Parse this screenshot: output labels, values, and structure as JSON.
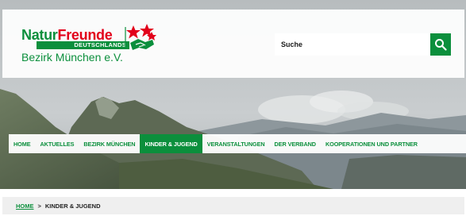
{
  "brand": {
    "name_part1": "Natur",
    "name_part2": "Freunde",
    "country": "DEUTSCHLANDS",
    "district": "Bezirk München e.V.",
    "mark_icon": "naturfreunde-handshake-roses-icon",
    "colors": {
      "green": "#0b8f3c",
      "red": "#e2001a"
    }
  },
  "search": {
    "placeholder": "Suche",
    "button_icon": "search-icon"
  },
  "nav": {
    "items": [
      {
        "label": "HOME"
      },
      {
        "label": "AKTUELLES"
      },
      {
        "label": "BEZIRK MÜNCHEN"
      },
      {
        "label": "KINDER & JUGEND",
        "active": true
      },
      {
        "label": "VERANSTALTUNGEN"
      },
      {
        "label": "DER VERBAND"
      },
      {
        "label": "KOOPERATIONEN UND PARTNER"
      }
    ]
  },
  "breadcrumb": {
    "home": "HOME",
    "separator": ">",
    "current": "KINDER & JUGEND"
  }
}
